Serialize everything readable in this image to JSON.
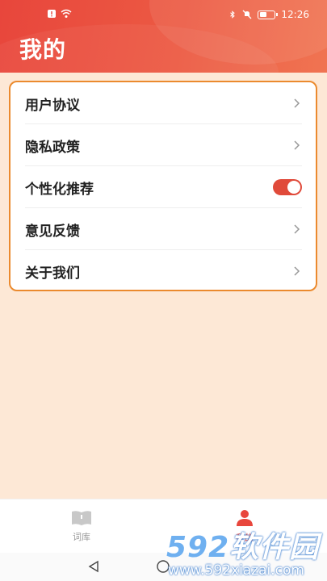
{
  "status_bar": {
    "time": "12:26"
  },
  "header": {
    "title": "我的"
  },
  "settings": {
    "items": [
      {
        "label": "用户协议",
        "control": "chevron"
      },
      {
        "label": "隐私政策",
        "control": "chevron"
      },
      {
        "label": "个性化推荐",
        "control": "toggle",
        "enabled": true
      },
      {
        "label": "意见反馈",
        "control": "chevron"
      },
      {
        "label": "关于我们",
        "control": "chevron"
      }
    ]
  },
  "bottom_nav": {
    "tabs": [
      {
        "label": "词库",
        "icon": "book-icon",
        "active": false
      },
      {
        "label": "我的",
        "icon": "person-icon",
        "active": true
      }
    ]
  },
  "watermark": {
    "brand_number": "592",
    "brand_text": "软件园",
    "url": "www.592xiazai.com"
  },
  "colors": {
    "accent": "#e8463c",
    "card_border": "#eb8a2e",
    "page_bg": "#fde8d6"
  }
}
